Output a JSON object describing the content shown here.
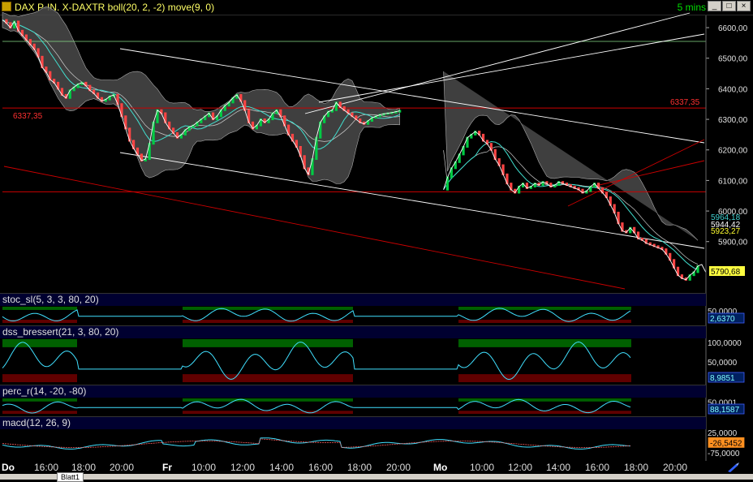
{
  "window": {
    "title": "DAX P-IN. X-DAXTR boll(20, 2, -2) move(9, 0)",
    "interval": "5 mins",
    "buttons": [
      "_",
      "□",
      "×"
    ]
  },
  "colors": {
    "background": "#000000",
    "price_line": "#ffffff",
    "bollinger_band": "#5a5a5a",
    "bull_candle": "#00cc44",
    "bear_candle": "#ff4444",
    "moving_average": "#40e0d0",
    "trendline_white": "#ffffff",
    "trendline_red": "#cc0000",
    "overbought_zone": "#006000",
    "oversold_zone": "#600000",
    "oscillator_line": "#40e0ff"
  },
  "chart_data": [
    {
      "type": "line",
      "panel": "price",
      "y_ticks": [
        "6600,00",
        "6500,00",
        "6400,00",
        "6300,00",
        "6200,00",
        "6100,00",
        "6000,00",
        "5900,00"
      ],
      "ylim": [
        5740,
        6640
      ],
      "x_ticks": [
        "Do",
        "16:00",
        "18:00",
        "20:00",
        "Fr",
        "10:00",
        "12:00",
        "14:00",
        "16:00",
        "18:00",
        "20:00",
        "Mo",
        "10:00",
        "12:00",
        "14:00",
        "16:00",
        "18:00",
        "20:00"
      ],
      "x": [
        0,
        1,
        2,
        3,
        4,
        5,
        6,
        7,
        8,
        9,
        10,
        11,
        12,
        13,
        14,
        15,
        16,
        17,
        18,
        19,
        20,
        21,
        22,
        23,
        24,
        25,
        26,
        27,
        28,
        29,
        30,
        31,
        32,
        33,
        34,
        35,
        36,
        37,
        38,
        39,
        40,
        41,
        42,
        43,
        44,
        45,
        46,
        47,
        48,
        49,
        50,
        51,
        52,
        53,
        54,
        55,
        56,
        57,
        58,
        59,
        60,
        61,
        62,
        63,
        64,
        65,
        66,
        67,
        68,
        69,
        70,
        71,
        72,
        73,
        74,
        75,
        76,
        77,
        78,
        79,
        80,
        81,
        82,
        83,
        84,
        85,
        86,
        87,
        88,
        89,
        90,
        91,
        92,
        93,
        94,
        95,
        96,
        97,
        98,
        99,
        100,
        101,
        102,
        103,
        104,
        105,
        106,
        107,
        108,
        109,
        110,
        111,
        112,
        113,
        114,
        115,
        116,
        117,
        118,
        119,
        120,
        121,
        122,
        123,
        124,
        125,
        126,
        127,
        128,
        129,
        130,
        131,
        132,
        133,
        134,
        135,
        136,
        137,
        138,
        139,
        140,
        141,
        142,
        143,
        144,
        145,
        146,
        147,
        148,
        149,
        150,
        151,
        152,
        153,
        154,
        155,
        156,
        157,
        158,
        159,
        160,
        161,
        162,
        163,
        164,
        165,
        166,
        167,
        168,
        169,
        170,
        171,
        172,
        173,
        174,
        175
      ],
      "series": [
        {
          "name": "",
          "values": [
            6625,
            6615,
            6600,
            6620,
            6590,
            6575,
            6560,
            6545,
            6530,
            6505,
            6470,
            6455,
            6430,
            6420,
            6400,
            6380,
            6370,
            6395,
            6405,
            6415,
            6420,
            6410,
            6395,
            6385,
            6370,
            6360,
            6365,
            6375,
            6380,
            6350,
            6310,
            6270,
            6230,
            6205,
            6185,
            6165,
            6170,
            6220,
            6290,
            6330,
            6320,
            6290,
            6270,
            6255,
            6240,
            6250,
            6265,
            6275,
            6280,
            6290,
            6300,
            6310,
            6320,
            6300,
            6310,
            6330,
            6345,
            6355,
            6370,
            6380,
            6360,
            6330,
            6290,
            6270,
            6280,
            6300,
            6290,
            6300,
            6320,
            6330,
            6310,
            6280,
            6250,
            6230,
            6210,
            6180,
            6140,
            6120,
            6170,
            6240,
            6290,
            6310,
            6325,
            6330,
            6355,
            6340,
            6330,
            6320,
            6310,
            6300,
            6290,
            6285,
            6295,
            6305,
            6310,
            6315,
            6318,
            6320,
            6322,
            6325,
            6328,
            null,
            null,
            null,
            null,
            null,
            null,
            null,
            null,
            null,
            null,
            6070,
            6110,
            6140,
            6160,
            6185,
            6210,
            6240,
            6250,
            6260,
            6250,
            6230,
            6220,
            6200,
            6170,
            6150,
            6120,
            6090,
            6070,
            6060,
            6080,
            6090,
            6075,
            6080,
            6090,
            6085,
            6095,
            6090,
            6080,
            6085,
            6095,
            6090,
            6085,
            6080,
            6075,
            6070,
            6060,
            6065,
            6080,
            6090,
            6075,
            6060,
            6045,
            6020,
            5995,
            5960,
            5935,
            5930,
            5945,
            5930,
            5910,
            5905,
            5895,
            5890,
            5885,
            5880,
            5875,
            5860,
            5840,
            5815,
            5790,
            5780,
            5775,
            5790,
            5800,
            5820,
            5825,
            5800
          ]
        }
      ],
      "annotations": [
        "6337,35",
        "6337,35"
      ],
      "price_labels": [
        "5964,18",
        "5944,42",
        "5923,27",
        "5790,68"
      ]
    },
    {
      "type": "line",
      "panel": "stoc_sl",
      "title": "stoc_sl(5, 3, 3, 80, 20)",
      "y_ticks": [
        "50,0000"
      ],
      "value_label": "2,6370",
      "ylim": [
        0,
        100
      ]
    },
    {
      "type": "line",
      "panel": "dss_bressert",
      "title": "dss_bressert(21, 3, 80, 20)",
      "y_ticks": [
        "100,0000",
        "50,0000"
      ],
      "value_label": "8,9851",
      "ylim": [
        0,
        100
      ]
    },
    {
      "type": "line",
      "panel": "perc_r",
      "title": "perc_r(14, -20, -80)",
      "y_ticks": [
        "50,0001"
      ],
      "value_label": "88,1587",
      "ylim": [
        -100,
        0
      ]
    },
    {
      "type": "line",
      "panel": "macd",
      "title": "macd(12, 26, 9)",
      "y_ticks": [
        "25,0000",
        "-75,0000"
      ],
      "value_label": "-26,5452",
      "ylim": [
        -75,
        25
      ]
    }
  ],
  "footer": {
    "sheet_tab": "Blatt1"
  }
}
